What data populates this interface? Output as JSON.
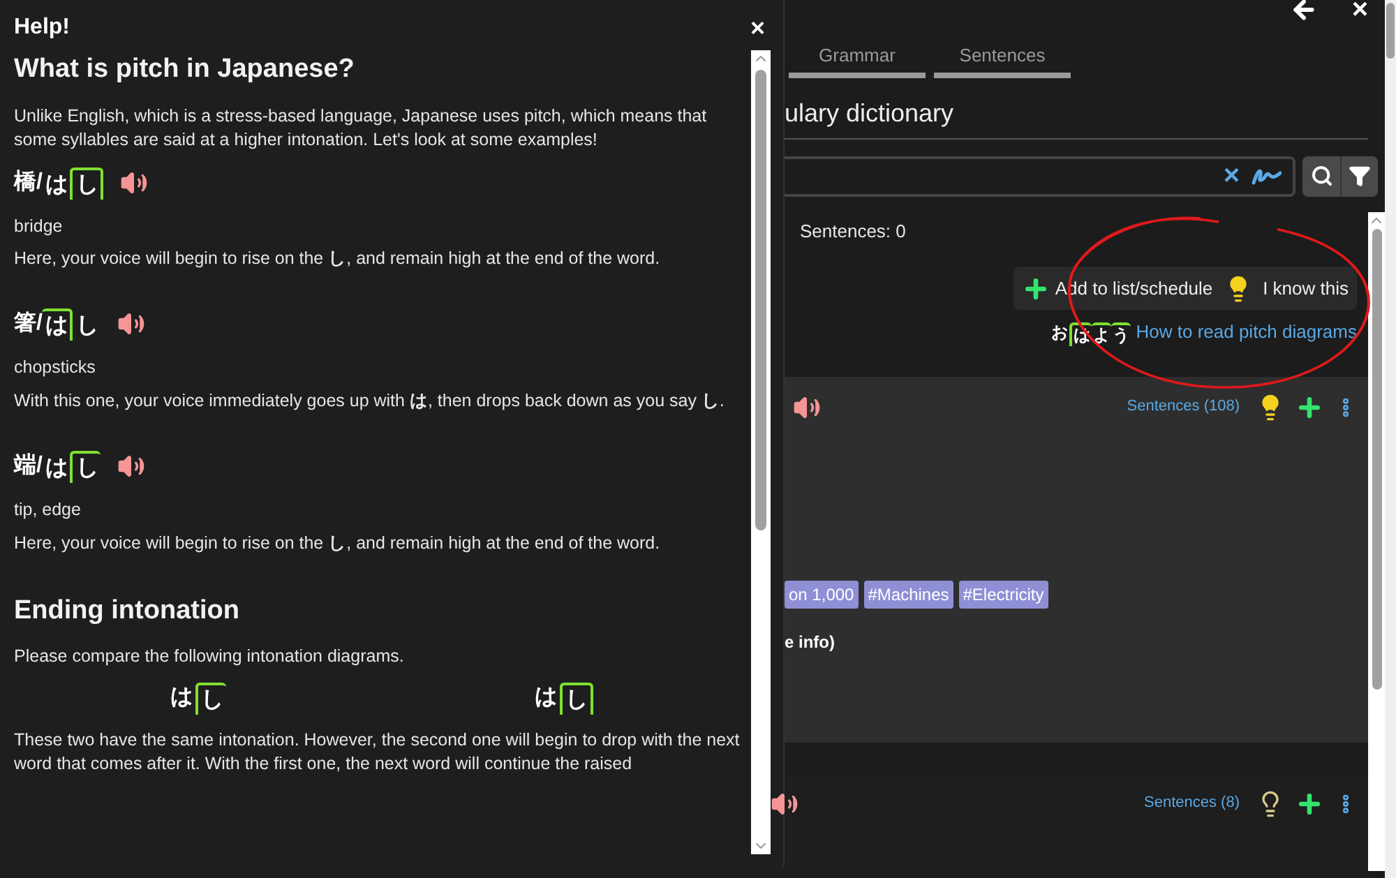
{
  "help_dialog": {
    "title": "Help!",
    "close": "×",
    "blocks": [
      {
        "kind": "heading",
        "text": "What is pitch in Japanese?"
      },
      {
        "kind": "paragraph",
        "text": "Unlike English, which is a stress-based language, Japanese uses pitch, which means that some syllables are said at a higher intonation. Let's look at some examples!"
      },
      {
        "kind": "word",
        "kanji": "橋",
        "separator": "/",
        "morae": [
          {
            "text": "は",
            "high": false
          },
          {
            "text": "し",
            "high": true
          }
        ],
        "drop": true,
        "meaning": "bridge",
        "explanation": "Here, your voice will begin to rise on the **し**, and remain high at the end of the word."
      },
      {
        "kind": "word",
        "kanji": "箸",
        "separator": "/",
        "morae": [
          {
            "text": "は",
            "high": true
          },
          {
            "text": "し",
            "high": false
          }
        ],
        "drop": false,
        "meaning": "chopsticks",
        "explanation": "With this one, your voice immediately goes up with **は**, then drops back down as you say **し**."
      },
      {
        "kind": "word",
        "kanji": "端",
        "separator": "/",
        "morae": [
          {
            "text": "は",
            "high": false
          },
          {
            "text": "し",
            "high": true
          }
        ],
        "drop": false,
        "meaning": "tip, edge",
        "explanation": "Here, your voice will begin to rise on the **し**, and remain high at the end of the word."
      },
      {
        "kind": "heading",
        "text": "Ending intonation"
      },
      {
        "kind": "paragraph",
        "text": "Please compare the following intonation diagrams."
      },
      {
        "kind": "compare",
        "items": [
          {
            "morae": [
              {
                "text": "は",
                "high": false
              },
              {
                "text": "し",
                "high": true
              }
            ],
            "drop": false
          },
          {
            "morae": [
              {
                "text": "は",
                "high": false
              },
              {
                "text": "し",
                "high": true
              }
            ],
            "drop": true
          }
        ]
      },
      {
        "kind": "paragraph",
        "text": "These two have the same intonation. However, the second one will begin to drop with the next word that comes after it. With the first one, the next word will continue the raised"
      }
    ]
  },
  "app": {
    "close": "×",
    "tabs": [
      {
        "label": "Grammar",
        "selected": false
      },
      {
        "label": "Sentences",
        "selected": false
      }
    ],
    "title": "ulary dictionary",
    "search": {
      "clear": "×"
    },
    "results": {
      "sentence_count": "Sentences: 0",
      "add_button": "Add to list/schedule",
      "know_button": "I know this",
      "pitch_example": {
        "morae": [
          {
            "text": "お",
            "high": false
          },
          {
            "text": "は",
            "high": true
          },
          {
            "text": "よ",
            "high": true
          },
          {
            "text": "う",
            "high": true
          }
        ],
        "drop": false
      },
      "pitch_link": "How to read pitch diagrams",
      "entries": [
        {
          "sentences_link": "Sentences (108)",
          "known": true,
          "tags": [
            "on 1,000",
            "#Machines",
            "#Electricity"
          ],
          "info": "e info)",
          "shaded": true
        },
        {
          "sentences_link": "Sentences (8)",
          "known": false,
          "shaded": false
        }
      ]
    }
  }
}
